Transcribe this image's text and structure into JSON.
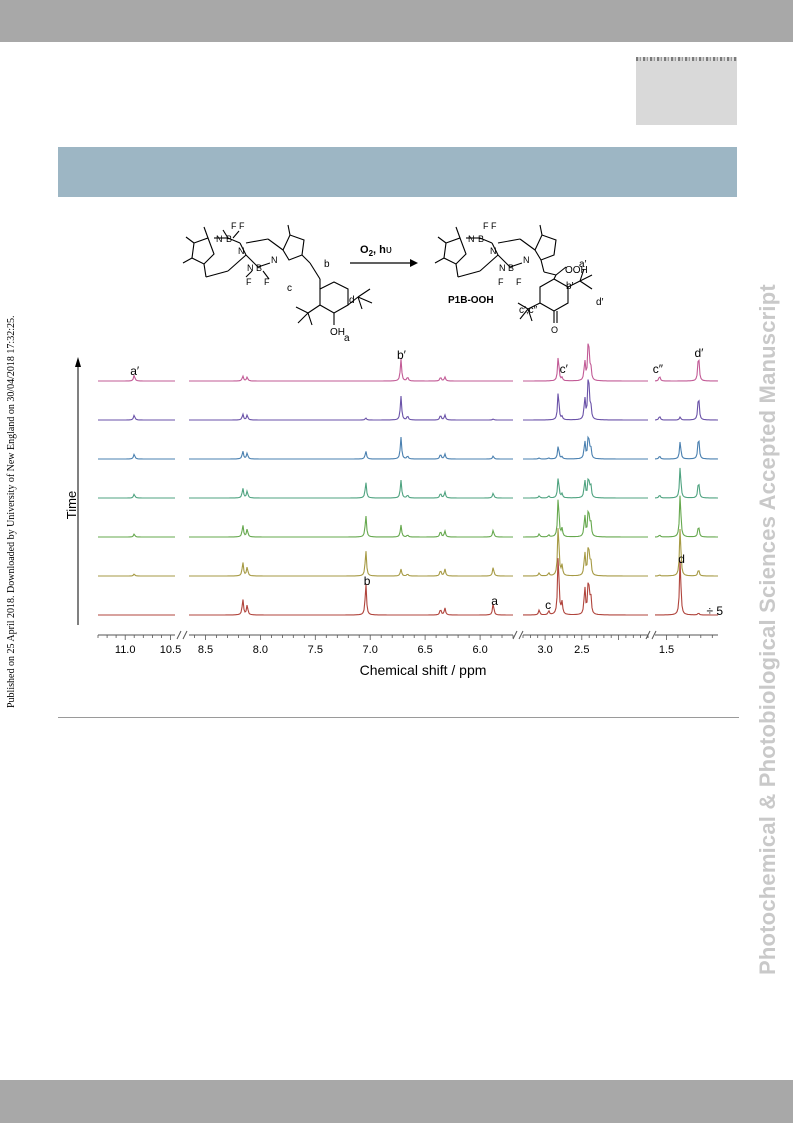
{
  "watermark": "Photochemical & Photobiological Sciences Accepted Manuscript",
  "side_note": "Published on 25 April 2018. Downloaded by University of New England on 30/04/2018 17:32:25.",
  "scheme": {
    "reagent": "O",
    "reagent_sub": "2",
    "reagent_suffix": ", h",
    "reagent_nu": "υ",
    "product_label": "P1B-OOH"
  },
  "chart_data": {
    "type": "line",
    "xlabel": "Chemical shift / ppm",
    "ylabel": "Time",
    "x_reversed": true,
    "axis_segments": [
      {
        "from": 11.3,
        "to": 10.45,
        "ticks": [
          "11.0",
          "10.5"
        ]
      },
      {
        "from": 8.65,
        "to": 5.7,
        "ticks": [
          "8.5",
          "8.0",
          "7.5",
          "7.0",
          "6.5",
          "6.0"
        ]
      },
      {
        "from": 3.3,
        "to": 1.6,
        "ticks": [
          "3.0",
          "2.5"
        ]
      },
      {
        "from": 1.6,
        "to": 1.05,
        "ticks": [
          "1.5"
        ]
      }
    ],
    "traces": 7,
    "trace_colors": [
      "#c25b96",
      "#6a52a8",
      "#4a80b0",
      "#4fa380",
      "#66a84e",
      "#a69a44",
      "#b0443c"
    ],
    "annotations": [
      {
        "label": "a′",
        "ppm": 10.9,
        "trace": "top"
      },
      {
        "label": "b′",
        "ppm": 6.72,
        "trace": "top"
      },
      {
        "label": "c′",
        "ppm": 2.72,
        "trace": "top"
      },
      {
        "label": "c″",
        "ppm": 1.55,
        "trace": "top"
      },
      {
        "label": "d′",
        "ppm": 1.22,
        "trace": "top"
      },
      {
        "label": "b",
        "ppm": 7.04,
        "trace": "bottom"
      },
      {
        "label": "a",
        "ppm": 5.88,
        "trace": "bottom"
      },
      {
        "label": "c",
        "ppm": 3.0,
        "trace": "bottom"
      },
      {
        "label": "d",
        "ppm": 1.38,
        "trace": "bottom"
      },
      {
        "label": "÷ 5*",
        "ppm": 1.15,
        "trace": "bottom"
      }
    ]
  },
  "structure_labels": {
    "reactant": [
      "b",
      "c",
      "d",
      "OH",
      "a"
    ],
    "product": [
      "a′",
      "OOH",
      "d′",
      "b′",
      "c′,c″"
    ]
  },
  "colors": {
    "header_band": "#9db6c4",
    "bars": "#a8a8a8",
    "watermark": "#c9c9c9"
  }
}
